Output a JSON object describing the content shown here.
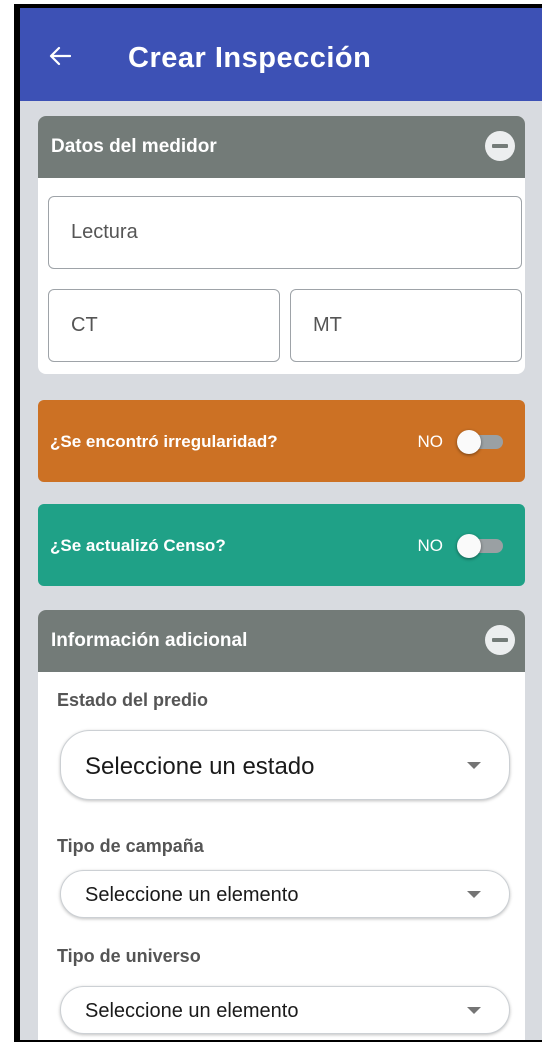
{
  "appbar": {
    "title": "Crear Inspección",
    "back_icon": "arrow-left-icon",
    "color": "#3d51b5"
  },
  "meter_card": {
    "title": "Datos del medidor",
    "collapse_icon": "minus-circle-icon",
    "fields": {
      "lectura_placeholder": "Lectura",
      "ct_placeholder": "CT",
      "mt_placeholder": "MT"
    }
  },
  "irregularity": {
    "label": "¿Se encontró irregularidad?",
    "state": "NO",
    "color": "#cc7124"
  },
  "census": {
    "label": "¿Se actualizó Censo?",
    "state": "NO",
    "color": "#1fa187"
  },
  "additional_card": {
    "title": "Información adicional",
    "collapse_icon": "minus-circle-icon",
    "estado_label": "Estado del predio",
    "estado_value": "Seleccione un estado",
    "campana_label": "Tipo de campaña",
    "campana_value": "Seleccione un elemento",
    "universo_label": "Tipo de universo",
    "universo_value": "Seleccione un elemento"
  }
}
